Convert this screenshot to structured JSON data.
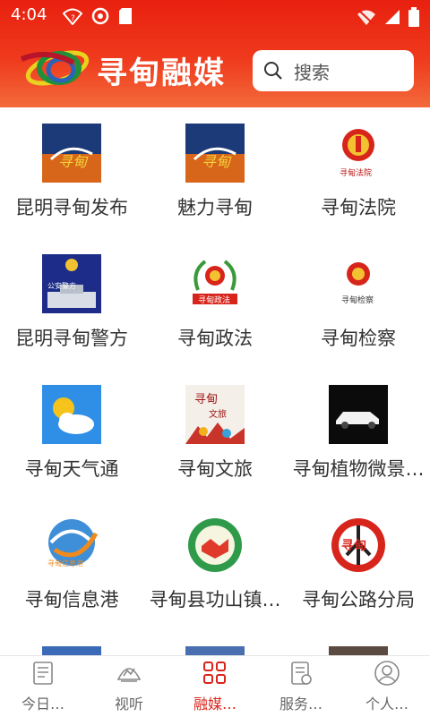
{
  "status_bar": {
    "time": "4:04"
  },
  "header": {
    "brand": "寻甸融媒",
    "search_placeholder": "搜索"
  },
  "grid": [
    {
      "label": "昆明寻甸发布",
      "icon": "xundian-sky-logo"
    },
    {
      "label": "魅力寻甸",
      "icon": "xundian-sky-logo"
    },
    {
      "label": "寻甸法院",
      "icon": "court-emblem"
    },
    {
      "label": "昆明寻甸警方",
      "icon": "police-building"
    },
    {
      "label": "寻甸政法",
      "icon": "politics-law-emblem"
    },
    {
      "label": "寻甸检察",
      "icon": "procuratorate-emblem"
    },
    {
      "label": "寻甸天气通",
      "icon": "weather-sun-cloud"
    },
    {
      "label": "寻甸文旅",
      "icon": "culture-tourism"
    },
    {
      "label": "寻甸植物微景…",
      "icon": "white-car"
    },
    {
      "label": "寻甸信息港",
      "icon": "info-port-logo"
    },
    {
      "label": "寻甸县功山镇…",
      "icon": "handshake-emblem"
    },
    {
      "label": "寻甸公路分局",
      "icon": "road-bureau-logo"
    }
  ],
  "nav": [
    {
      "label": "今日…",
      "icon": "news-icon",
      "active": false
    },
    {
      "label": "视听",
      "icon": "video-icon",
      "active": false
    },
    {
      "label": "融媒…",
      "icon": "grid-icon",
      "active": true
    },
    {
      "label": "服务…",
      "icon": "service-icon",
      "active": false
    },
    {
      "label": "个人…",
      "icon": "user-icon",
      "active": false
    }
  ],
  "colors": {
    "header_red": "#e8200f",
    "active_red": "#d9251c"
  }
}
